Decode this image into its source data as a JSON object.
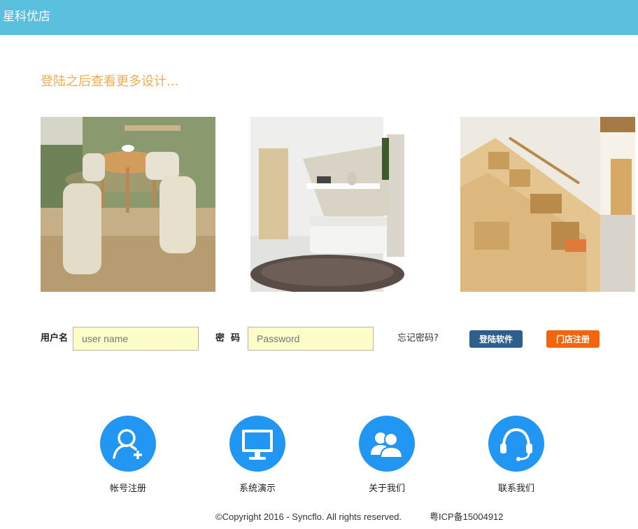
{
  "header": {
    "brand": "星科优店",
    "color": "#5bc0de"
  },
  "main": {
    "tagline": "登陆之后查看更多设计...",
    "photos": [
      {
        "name": "dining-set-photo"
      },
      {
        "name": "wall-bed-sofa-photo"
      },
      {
        "name": "storage-staircase-photo"
      }
    ]
  },
  "login": {
    "username_label": "用户名",
    "username_placeholder": "user name",
    "password_label": "密  码",
    "password_placeholder": "Password",
    "forgot": "忘记密码?",
    "login_button": "登陆软件",
    "store_register_button": "门店注册",
    "login_color": "#2c5f8d",
    "store_color": "#f2650a"
  },
  "features": [
    {
      "label": "帐号注册",
      "icon": "add-user-icon"
    },
    {
      "label": "系统演示",
      "icon": "monitor-icon"
    },
    {
      "label": "关于我们",
      "icon": "users-icon"
    },
    {
      "label": "联系我们",
      "icon": "headset-icon"
    }
  ],
  "footer": {
    "copyright": "©Copyright 2016 - Syncflo. All rights reserved.",
    "icp": "粤ICP备15004912"
  }
}
